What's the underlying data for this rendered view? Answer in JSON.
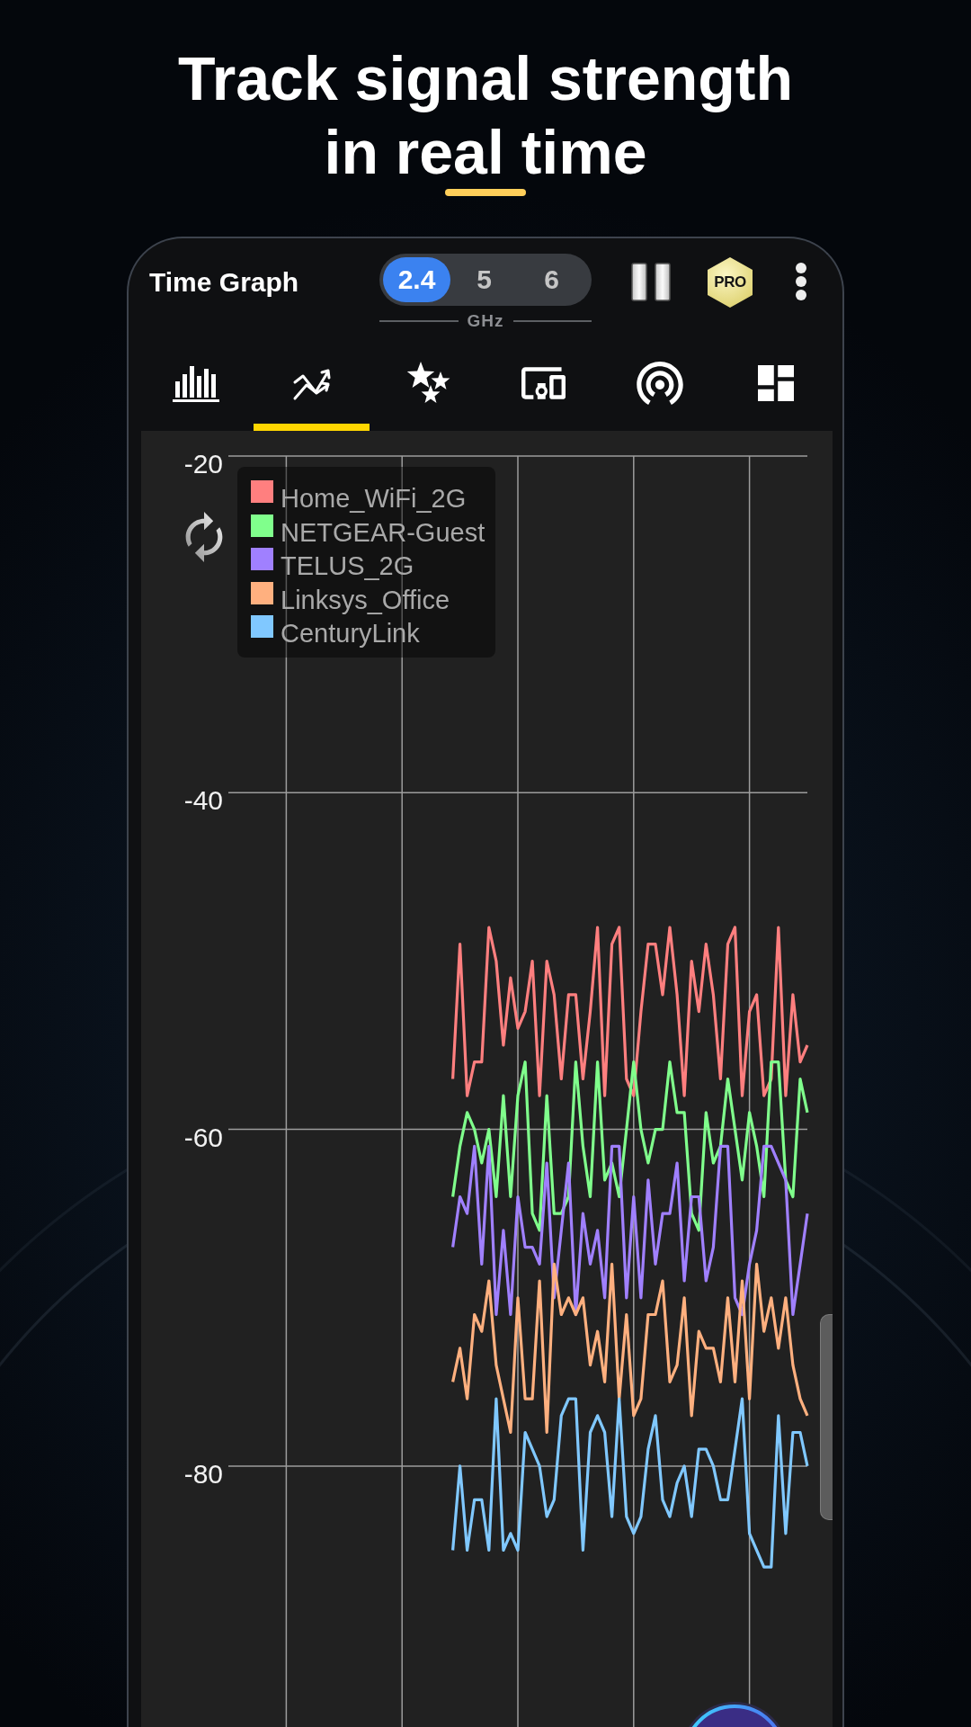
{
  "headline": "Track signal strength in real time",
  "app_bar": {
    "title": "Time Graph",
    "bands": [
      {
        "label": "2.4",
        "selected": true
      },
      {
        "label": "5",
        "selected": false
      },
      {
        "label": "6",
        "selected": false
      }
    ],
    "band_unit": "GHz",
    "badge": "PRO"
  },
  "tabs": [
    {
      "kind": "bars",
      "selected": false
    },
    {
      "kind": "trend",
      "selected": true
    },
    {
      "kind": "stars",
      "selected": false
    },
    {
      "kind": "devices",
      "selected": false
    },
    {
      "kind": "signal",
      "selected": false
    },
    {
      "kind": "dashboard",
      "selected": false
    }
  ],
  "time_graph": {
    "chart_data": {
      "type": "line",
      "ylim": [
        -95.5,
        -20
      ],
      "yticks": [
        -20,
        -40,
        -60,
        -80
      ],
      "grid": true,
      "legend": true,
      "series": [
        {
          "name": "Home_WiFi_2G",
          "color": "#ff7f7f",
          "values": [
            null,
            null,
            null,
            null,
            null,
            null,
            null,
            null,
            null,
            null,
            null,
            null,
            null,
            null,
            null,
            null,
            null,
            null,
            null,
            null,
            null,
            null,
            null,
            null,
            null,
            null,
            null,
            null,
            null,
            null,
            null,
            -57,
            -49,
            -58,
            -56,
            -56,
            -48,
            -50,
            -55,
            -51,
            -54,
            -53,
            -50,
            -58,
            -50,
            -52,
            -57,
            -52,
            -52,
            -57,
            -53,
            -48,
            -58,
            -49,
            -48,
            -57,
            -58,
            -53,
            -49,
            -49,
            -52,
            -48,
            -52,
            -58,
            -50,
            -53,
            -49,
            -52,
            -57,
            -49,
            -48,
            -58,
            -53,
            -52,
            -58,
            -57,
            -48,
            -58,
            -52,
            -56,
            -55
          ]
        },
        {
          "name": "NETGEAR-Guest",
          "color": "#80ff8c",
          "values": [
            null,
            null,
            null,
            null,
            null,
            null,
            null,
            null,
            null,
            null,
            null,
            null,
            null,
            null,
            null,
            null,
            null,
            null,
            null,
            null,
            null,
            null,
            null,
            null,
            null,
            null,
            null,
            null,
            null,
            null,
            null,
            -64,
            -61,
            -59,
            -60,
            -62,
            -60,
            -64,
            -58,
            -64,
            -58,
            -56,
            -65,
            -66,
            -58,
            -65,
            -65,
            -64,
            -56,
            -61,
            -64,
            -56,
            -63,
            -62,
            -64,
            -60,
            -56,
            -60,
            -62,
            -60,
            -60,
            -56,
            -59,
            -59,
            -65,
            -66,
            -59,
            -62,
            -61,
            -57,
            -60,
            -63,
            -59,
            -61,
            -64,
            -56,
            -56,
            -63,
            -64,
            -57,
            -59
          ]
        },
        {
          "name": "TELUS_2G",
          "color": "#a080ff",
          "values": [
            null,
            null,
            null,
            null,
            null,
            null,
            null,
            null,
            null,
            null,
            null,
            null,
            null,
            null,
            null,
            null,
            null,
            null,
            null,
            null,
            null,
            null,
            null,
            null,
            null,
            null,
            null,
            null,
            null,
            null,
            null,
            -67,
            -64,
            -65,
            -61,
            -68,
            -61,
            -71,
            -66,
            -71,
            -64,
            -67,
            -67,
            -68,
            -62,
            -70,
            -66,
            -62,
            -71,
            -65,
            -68,
            -66,
            -70,
            -61,
            -61,
            -70,
            -64,
            -70,
            -63,
            -68,
            -65,
            -65,
            -62,
            -69,
            -64,
            -64,
            -69,
            -67,
            -61,
            -61,
            -70,
            -71,
            -68,
            -66,
            -61,
            -61,
            -62,
            -63,
            -71,
            -68,
            -65
          ]
        },
        {
          "name": "Linksys_Office",
          "color": "#ffb07f",
          "values": [
            null,
            null,
            null,
            null,
            null,
            null,
            null,
            null,
            null,
            null,
            null,
            null,
            null,
            null,
            null,
            null,
            null,
            null,
            null,
            null,
            null,
            null,
            null,
            null,
            null,
            null,
            null,
            null,
            null,
            null,
            null,
            -75,
            -73,
            -76,
            -71,
            -72,
            -69,
            -74,
            -76,
            -78,
            -70,
            -76,
            -76,
            -69,
            -78,
            -68,
            -71,
            -70,
            -71,
            -70,
            -74,
            -72,
            -75,
            -68,
            -76,
            -71,
            -77,
            -76,
            -71,
            -71,
            -69,
            -75,
            -74,
            -70,
            -77,
            -72,
            -73,
            -73,
            -75,
            -70,
            -75,
            -69,
            -76,
            -68,
            -72,
            -70,
            -73,
            -70,
            -74,
            -76,
            -77
          ]
        },
        {
          "name": "CenturyLink",
          "color": "#80c8ff",
          "values": [
            null,
            null,
            null,
            null,
            null,
            null,
            null,
            null,
            null,
            null,
            null,
            null,
            null,
            null,
            null,
            null,
            null,
            null,
            null,
            null,
            null,
            null,
            null,
            null,
            null,
            null,
            null,
            null,
            null,
            null,
            null,
            -85,
            -80,
            -85,
            -82,
            -82,
            -85,
            -76,
            -85,
            -84,
            -85,
            -78,
            -79,
            -80,
            -83,
            -82,
            -77,
            -76,
            -76,
            -85,
            -78,
            -77,
            -78,
            -83,
            -76,
            -83,
            -84,
            -83,
            -79,
            -77,
            -82,
            -83,
            -81,
            -80,
            -83,
            -79,
            -79,
            -80,
            -82,
            -82,
            -79,
            -76,
            -84,
            -85,
            -86,
            -86,
            -77,
            -84,
            -78,
            -78,
            -80
          ]
        }
      ]
    }
  }
}
